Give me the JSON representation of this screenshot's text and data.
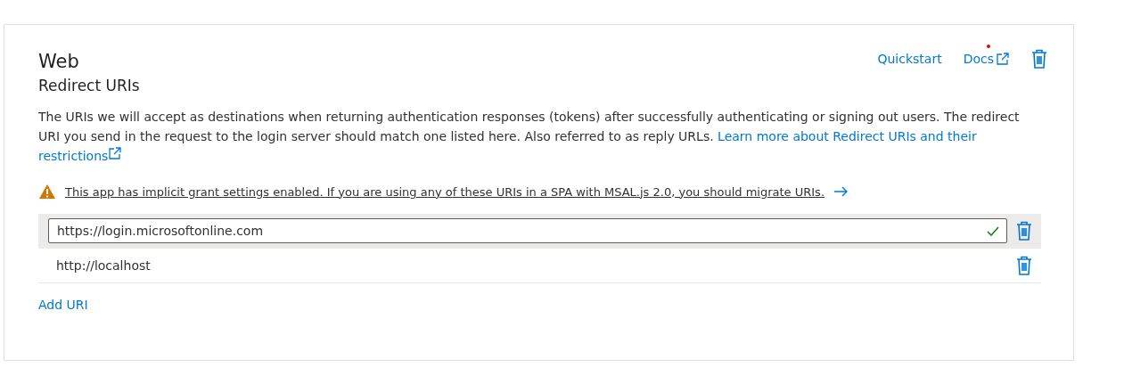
{
  "card": {
    "title": "Web",
    "subtitle": "Redirect URIs",
    "links": [
      {
        "label": "Quickstart",
        "external": false
      },
      {
        "label": "Docs",
        "external": true
      }
    ],
    "description": "The URIs we will accept as destinations when returning authentication responses (tokens) after successfully authenticating or signing out users. The redirect URI you send in the request to the login server should match one listed here. Also referred to as reply URLs.",
    "description_link": [
      "Learn more about Redirect URIs and their",
      "restrictions"
    ],
    "warning": "This app has implicit grant settings enabled. If you are using any of these URIs in a SPA with MSAL.js 2.0, you should migrate URIs.",
    "uris": [
      {
        "value": "https://login.microsoftonline.com",
        "selected": true,
        "valid": true
      },
      {
        "value": "http://localhost",
        "selected": false,
        "valid": false
      }
    ],
    "add_button": "Add URI"
  }
}
